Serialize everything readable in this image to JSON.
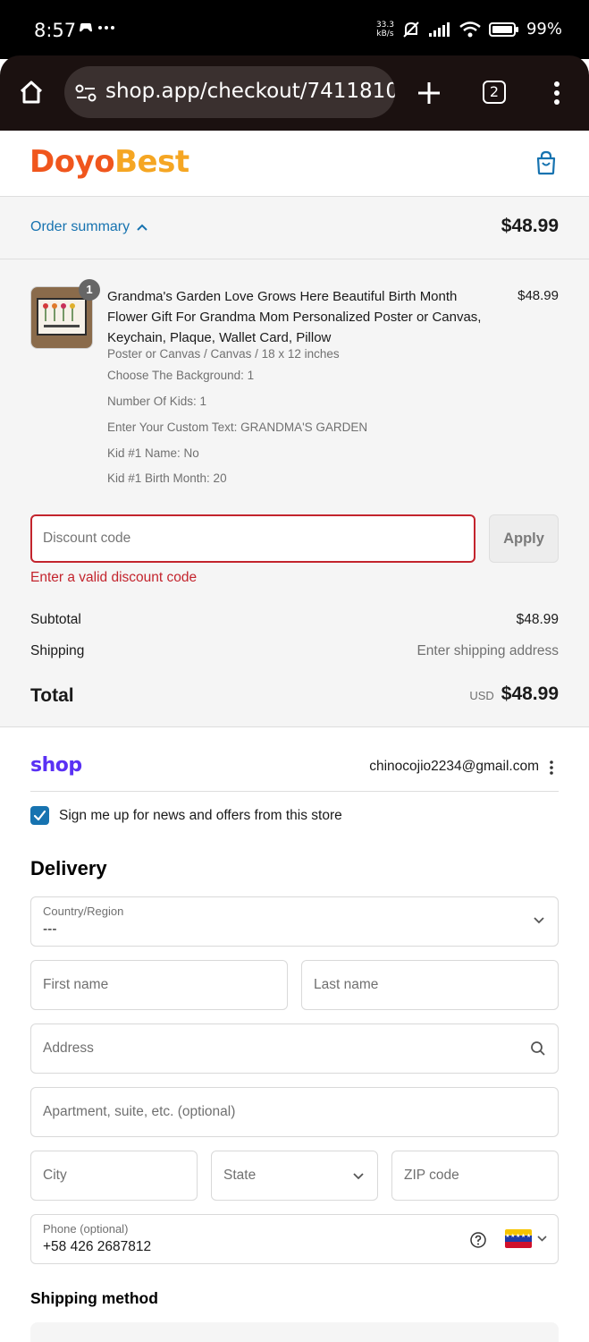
{
  "status_bar": {
    "time": "8:57",
    "net_speed_value": "33.3",
    "net_speed_unit": "kB/s",
    "battery": "99%"
  },
  "browser": {
    "url": "shop.app/checkout/741181033",
    "tab_count": "2"
  },
  "store": {
    "logo_part1": "Doyo",
    "logo_part2": "Best",
    "brand_colors": {
      "primary": "#f0561d",
      "secondary": "#f5a623"
    }
  },
  "summary": {
    "toggle_label": "Order summary",
    "total": "$48.99"
  },
  "line_item": {
    "quantity": "1",
    "title": "Grandma's Garden Love Grows Here Beautiful Birth Month Flower Gift For Grandma Mom Personalized Poster or Canvas, Keychain, Plaque, Wallet Card, Pillow",
    "price": "$48.99",
    "variant": "Poster or Canvas / Canvas / 18 x 12 inches",
    "properties": [
      "Choose The Background: 1",
      "Number Of Kids: 1",
      "Enter Your Custom Text: GRANDMA'S GARDEN",
      "Kid #1 Name: No",
      "Kid #1 Birth Month: 20"
    ]
  },
  "discount": {
    "placeholder": "Discount code",
    "apply_label": "Apply",
    "error": "Enter a valid discount code",
    "error_color": "#c3242d"
  },
  "totals": {
    "subtotal_label": "Subtotal",
    "subtotal_value": "$48.99",
    "shipping_label": "Shipping",
    "shipping_value": "Enter shipping address",
    "total_label": "Total",
    "currency": "USD",
    "total_value": "$48.99"
  },
  "account": {
    "shop_logo": "shop",
    "email": "chinocojio2234@gmail.com",
    "newsletter_label": "Sign me up for news and offers from this store",
    "newsletter_checked": true
  },
  "delivery": {
    "title": "Delivery",
    "country_label": "Country/Region",
    "country_value": "---",
    "first_name_placeholder": "First name",
    "last_name_placeholder": "Last name",
    "address_placeholder": "Address",
    "apartment_placeholder": "Apartment, suite, etc. (optional)",
    "city_placeholder": "City",
    "state_placeholder": "State",
    "zip_placeholder": "ZIP code",
    "phone_label": "Phone (optional)",
    "phone_value": "+58 426 2687812"
  },
  "shipping_method": {
    "title": "Shipping method"
  },
  "accent_color": "#1773b0"
}
